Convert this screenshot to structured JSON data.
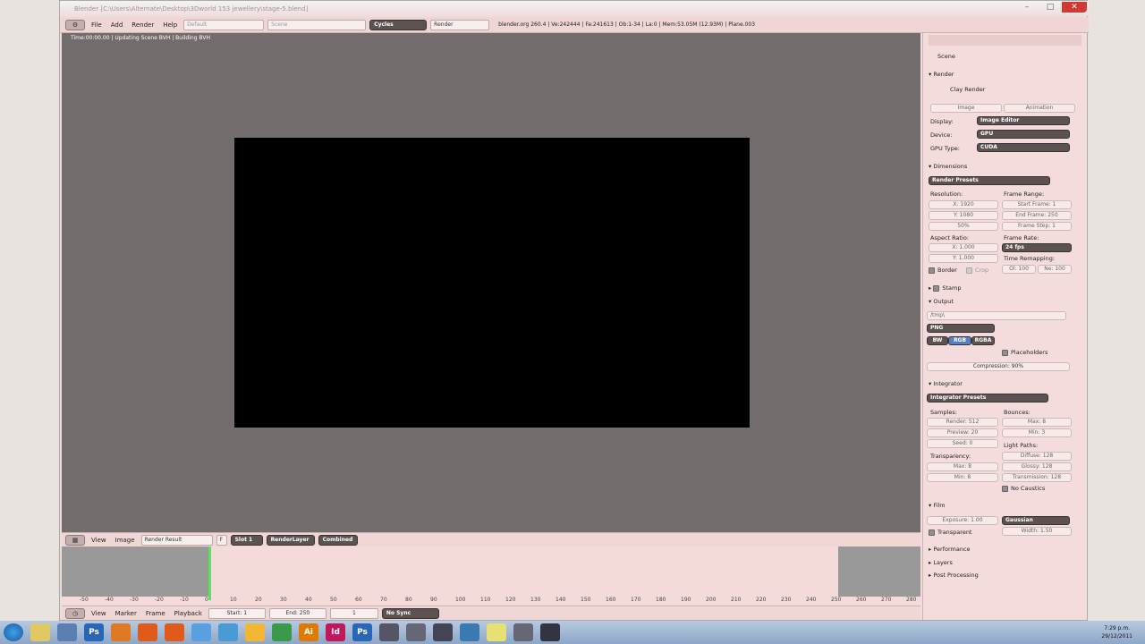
{
  "window": {
    "title": "Blender [C:\\Users\\Alternate\\Desktop\\3Dworld 153 jewellery\\stage-5.blend]",
    "min": "–",
    "max": "□",
    "close": "✕"
  },
  "topbar": {
    "editor": "⚙",
    "menu": [
      "File",
      "Add",
      "Render",
      "Help"
    ],
    "screen": "Default",
    "scene": "Scene",
    "engine": "Cycles",
    "render_field": "Render",
    "stats": "blender.org 260.4 | Ve:242444 | Fa:241613 | Ob:1-34 | La:0 | Mem:53.05M (12.93M) | Plane.003"
  },
  "viewport": {
    "status": "Time:00:00.00 | Updating Scene BVH | Building BVH"
  },
  "image_header": {
    "menus": [
      "View",
      "Image"
    ],
    "image_name": "Render Result",
    "fake": "F",
    "slot": "Slot 1",
    "layer": "RenderLayer",
    "pass": "Combined"
  },
  "timeline": {
    "ticks": [
      "-50",
      "-40",
      "-30",
      "-20",
      "-10",
      "0",
      "10",
      "20",
      "30",
      "40",
      "50",
      "60",
      "70",
      "80",
      "90",
      "100",
      "110",
      "120",
      "130",
      "140",
      "150",
      "160",
      "170",
      "180",
      "190",
      "200",
      "210",
      "220",
      "230",
      "240",
      "250",
      "260",
      "270",
      "280"
    ]
  },
  "timeline_header": {
    "menus": [
      "View",
      "Marker",
      "Frame",
      "Playback"
    ],
    "start": "Start: 1",
    "end": "End: 250",
    "current": "1",
    "sync": "No Sync"
  },
  "properties": {
    "context": "Scene",
    "render": {
      "header": "Render",
      "clay": "Clay Render",
      "image_btn": "Image",
      "anim_btn": "Animation",
      "display_label": "Display:",
      "display": "Image Editor",
      "device_label": "Device:",
      "device": "GPU",
      "gputype_label": "GPU Type:",
      "gputype": "CUDA"
    },
    "dimensions": {
      "header": "Dimensions",
      "presets": "Render Presets",
      "resolution": "Resolution:",
      "x": "X: 1920",
      "y": "Y: 1080",
      "percent": "50%",
      "frame_range": "Frame Range:",
      "start": "Start Frame: 1",
      "end": "End Frame: 250",
      "step": "Frame Step: 1",
      "aspect": "Aspect Ratio:",
      "ax": "X: 1.000",
      "ay": "Y: 1.000",
      "frame_rate": "Frame Rate:",
      "fps": "24 fps",
      "time_remap": "Time Remapping:",
      "old": "Ol: 100",
      "new": "Ne: 100",
      "border": "Border",
      "crop": "Crop"
    },
    "stamp": {
      "header": "Stamp"
    },
    "output": {
      "header": "Output",
      "path": "/tmp\\",
      "format": "PNG",
      "bw": "BW",
      "rgb": "RGB",
      "rgba": "RGBA",
      "placeholders": "Placeholders",
      "compression": "Compression: 90%"
    },
    "integrator": {
      "header": "Integrator",
      "presets": "Integrator Presets",
      "samples": "Samples:",
      "render": "Render: 512",
      "preview": "Preview: 20",
      "seed": "Seed: 0",
      "bounces": "Bounces:",
      "max": "Max: 8",
      "min": "Min: 3",
      "transparency": "Transparency:",
      "tmax": "Max: 8",
      "tmin": "Min: 8",
      "light_paths": "Light Paths:",
      "diffuse": "Diffuse: 128",
      "glossy": "Glossy: 128",
      "transmission": "Transmission: 128",
      "no_caustics": "No Caustics"
    },
    "film": {
      "header": "Film",
      "exposure": "Exposure: 1.00",
      "filter": "Gaussian",
      "transparent": "Transparent",
      "width": "Width: 1.50"
    },
    "collapsed": [
      "Performance",
      "Layers",
      "Post Processing"
    ]
  },
  "taskbar": {
    "time": "7:29 p.m.",
    "date": "29/12/2011"
  },
  "colors": {
    "viewport": "#726d6c",
    "panel": "#f4dcdc",
    "accent": "#5d5252"
  }
}
